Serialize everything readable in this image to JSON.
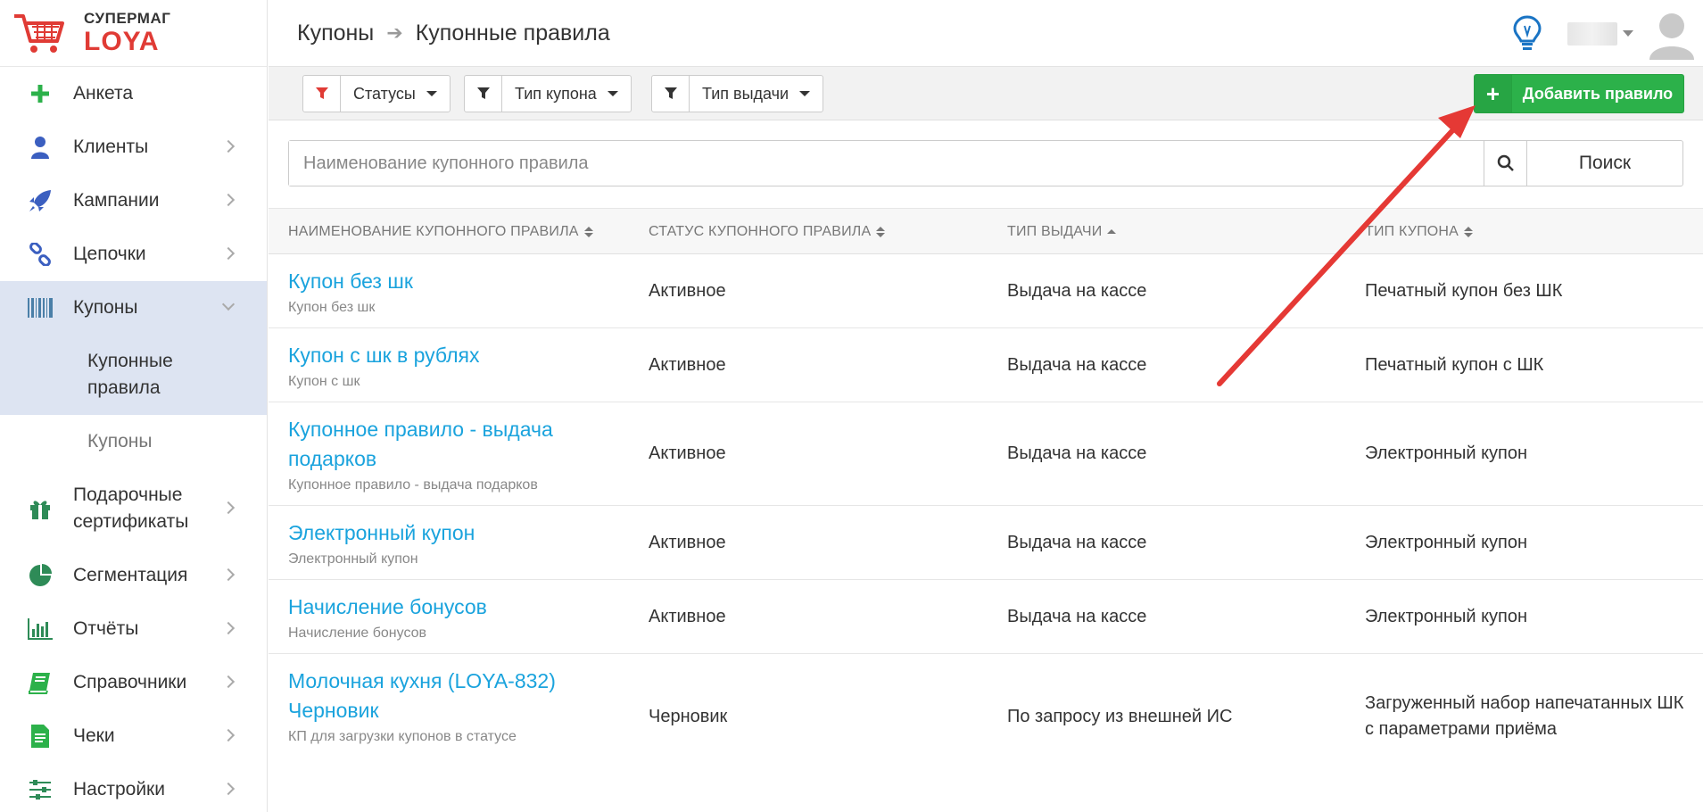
{
  "brand": {
    "small": "СУПЕРМАГ",
    "big": "LOYA"
  },
  "sidebar": {
    "items": [
      {
        "label": "Анкета",
        "icon": "plus-icon"
      },
      {
        "label": "Клиенты",
        "icon": "user-icon"
      },
      {
        "label": "Кампании",
        "icon": "rocket-icon"
      },
      {
        "label": "Цепочки",
        "icon": "chain-icon"
      },
      {
        "label": "Купоны",
        "icon": "barcode-icon"
      },
      {
        "label": "Подарочные сертификаты",
        "icon": "gift-icon"
      },
      {
        "label": "Сегментация",
        "icon": "pie-icon"
      },
      {
        "label": "Отчёты",
        "icon": "bar-chart-icon"
      },
      {
        "label": "Справочники",
        "icon": "book-icon"
      },
      {
        "label": "Чеки",
        "icon": "receipt-icon"
      },
      {
        "label": "Настройки",
        "icon": "sliders-icon"
      }
    ],
    "subitems": [
      {
        "label": "Купонные правила"
      },
      {
        "label": "Купоны"
      }
    ]
  },
  "header": {
    "crumb_parent": "Купоны",
    "crumb_current": "Купонные правила"
  },
  "filters": {
    "status": "Статусы",
    "coupon_type": "Тип купона",
    "issue_type": "Тип выдачи",
    "add_button": "Добавить правило"
  },
  "search": {
    "placeholder": "Наименование купонного правила",
    "button": "Поиск"
  },
  "table": {
    "columns": [
      "Наименование купонного правила",
      "Статус купонного правила",
      "Тип выдачи",
      "Тип купона"
    ],
    "rows": [
      {
        "name": "Купон без шк",
        "desc": "Купон без шк",
        "status": "Активное",
        "issue": "Выдача на кассе",
        "type": "Печатный купон без ШК"
      },
      {
        "name": "Купон с шк в рублях",
        "desc": "Купон с шк",
        "status": "Активное",
        "issue": "Выдача на кассе",
        "type": "Печатный купон с ШК"
      },
      {
        "name": "Купонное правило - выдача подарков",
        "desc": "Купонное правило - выдача подарков",
        "status": "Активное",
        "issue": "Выдача на кассе",
        "type": "Электронный купон"
      },
      {
        "name": "Электронный купон",
        "desc": "Электронный купон",
        "status": "Активное",
        "issue": "Выдача на кассе",
        "type": "Электронный купон"
      },
      {
        "name": "Начисление бонусов",
        "desc": "Начисление бонусов",
        "status": "Активное",
        "issue": "Выдача на кассе",
        "type": "Электронный купон"
      },
      {
        "name": "Молочная кухня (LOYA-832) Черновик",
        "desc": "КП для загрузки купонов в статусе",
        "status": "Черновик",
        "issue": "По запросу из внешней ИС",
        "type": "Загруженный набор напечатанных ШК с параметрами приёма"
      }
    ]
  },
  "colors": {
    "accent_link": "#1aa3dd",
    "add_button": "#2cb14a",
    "active_nav": "#dde4f2",
    "annotation_arrow": "#e53935"
  }
}
